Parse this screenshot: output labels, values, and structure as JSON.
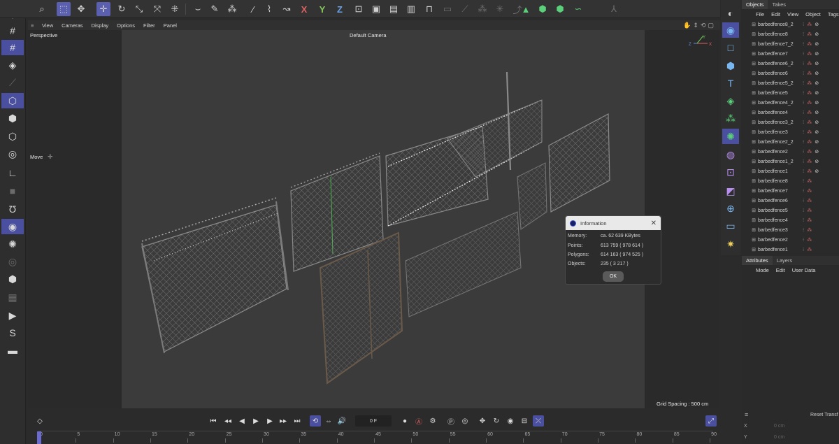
{
  "viewport_menu": [
    "View",
    "Cameras",
    "Display",
    "Options",
    "Filter",
    "Panel"
  ],
  "viewport": {
    "view_name": "Perspective",
    "camera": "Default Camera",
    "tool": "Move",
    "grid_spacing": "Grid Spacing : 500 cm",
    "axis_labels": [
      "Z",
      "X",
      "Y"
    ]
  },
  "info_dialog": {
    "title": "Information",
    "rows": [
      {
        "label": "Memory:",
        "value": "ca. 62 639 KBytes"
      },
      {
        "label": "Points:",
        "value": "613 759 ( 978 614 )"
      },
      {
        "label": "Polygons:",
        "value": "614 163 ( 974 525 )"
      },
      {
        "label": "Objects:",
        "value": "235 ( 3 217 )"
      }
    ],
    "ok": "OK"
  },
  "top_toolbar_letters": [
    "X",
    "Y",
    "Z"
  ],
  "object_panel": {
    "tabs": [
      "Objects",
      "Takes"
    ],
    "menu": [
      "File",
      "Edit",
      "View",
      "Object",
      "Tags"
    ],
    "objects": [
      "barbedfence8_2",
      "barbedfence8",
      "barbedfence7_2",
      "barbedfence7",
      "barbedfence6_2",
      "barbedfence6",
      "barbedfence5_2",
      "barbedfence5",
      "barbedfence4_2",
      "barbedfence4",
      "barbedfence3_2",
      "barbedfence3",
      "barbedfence2_2",
      "barbedfence2",
      "barbedfence1_2",
      "barbedfence1",
      "barbedfence8",
      "barbedfence7",
      "barbedfence6",
      "barbedfence5",
      "barbedfence4",
      "barbedfence3",
      "barbedfence2",
      "barbedfence1"
    ]
  },
  "attributes_panel": {
    "tabs": [
      "Attributes",
      "Layers"
    ],
    "menu": [
      "Mode",
      "Edit",
      "User Data"
    ],
    "reset_label": "Reset Transf",
    "x_label": "X",
    "x_value": "0 cm",
    "y_label": "Y",
    "y_value": "0 cm"
  },
  "timeline": {
    "frame_field": "0 F",
    "ruler": [
      "0",
      "5",
      "10",
      "15",
      "20",
      "25",
      "30",
      "35",
      "40",
      "45",
      "50",
      "55",
      "60",
      "65",
      "70",
      "75",
      "80",
      "85",
      "90"
    ]
  }
}
